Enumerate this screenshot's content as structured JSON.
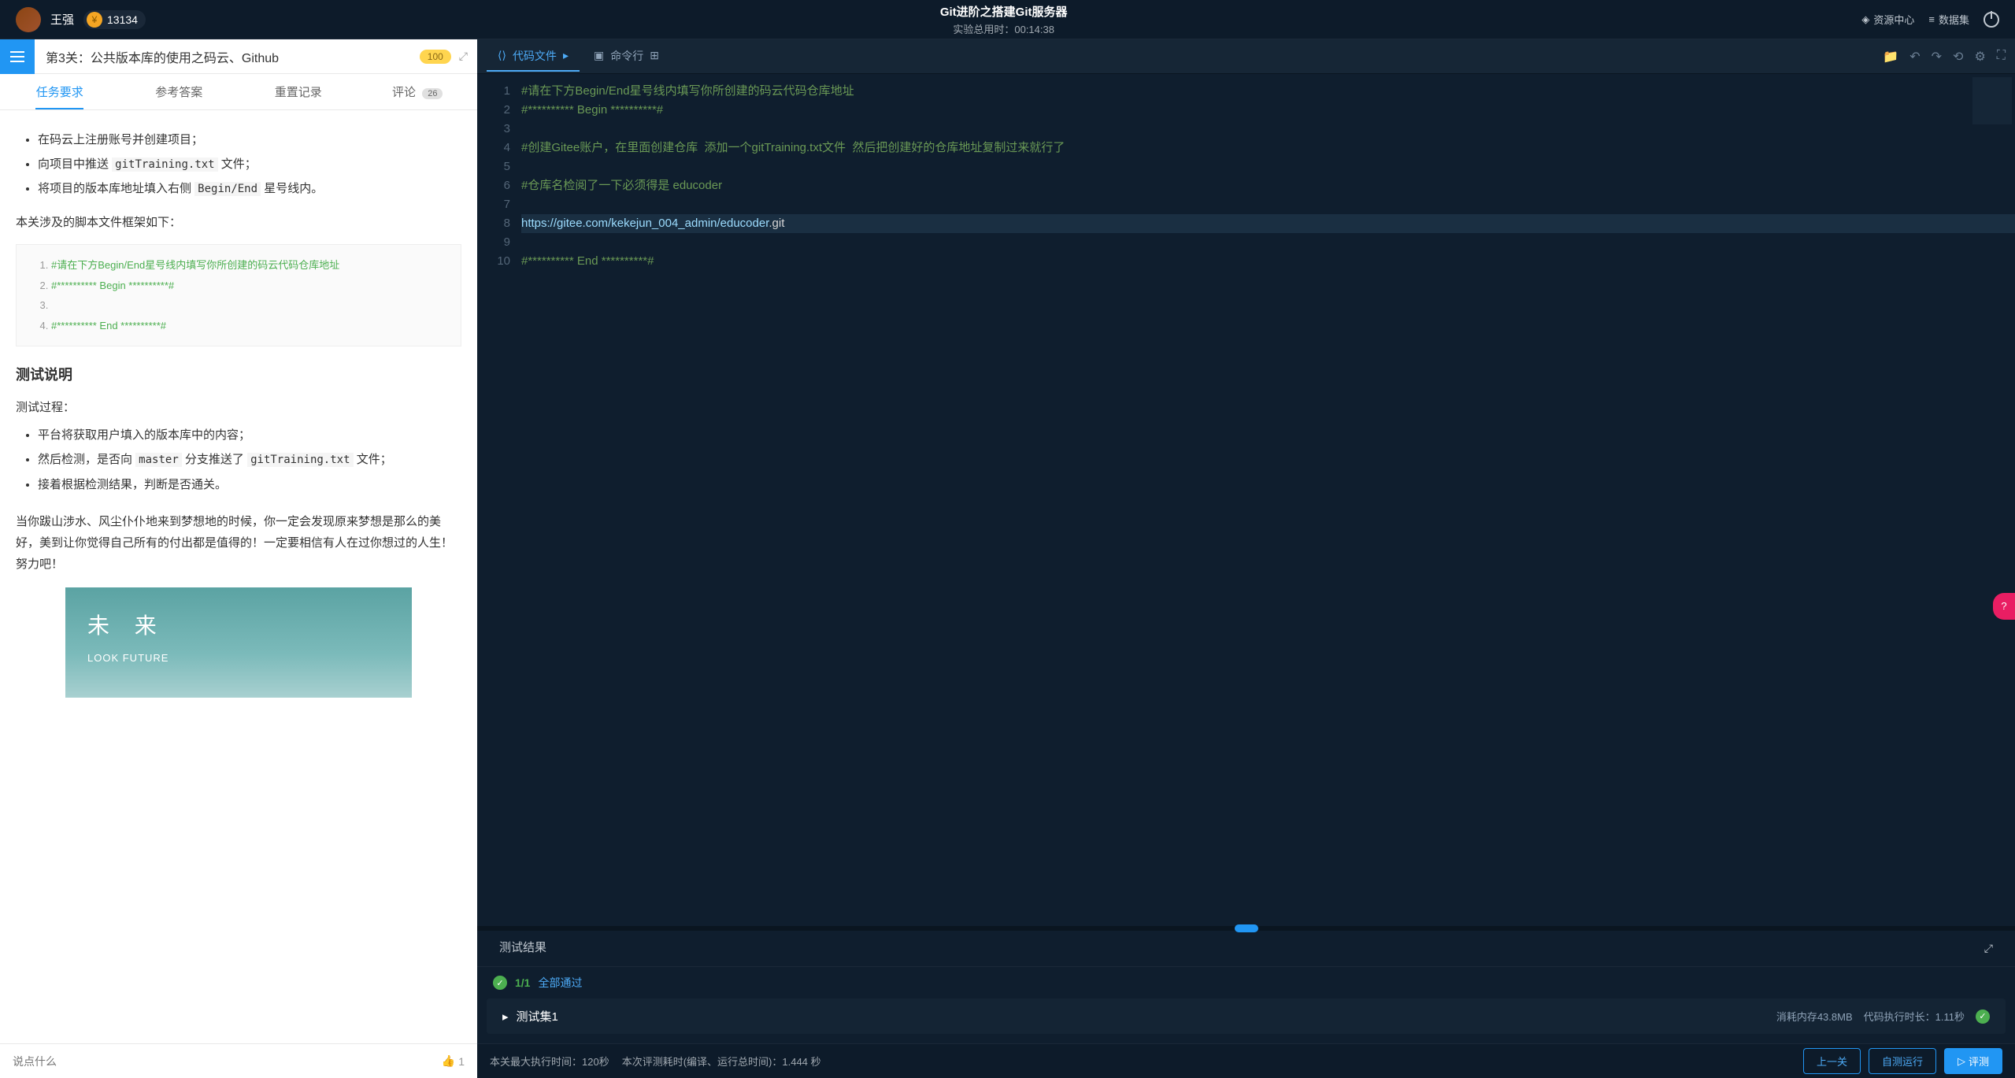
{
  "header": {
    "username": "王强",
    "coins": "13134",
    "title": "Git进阶之搭建Git服务器",
    "elapsed_label": "实验总用时：",
    "elapsed_time": "00:14:38",
    "resource_center": "资源中心",
    "dataset": "数据集"
  },
  "level": {
    "title": "第3关：公共版本库的使用之码云、Github",
    "score": "100"
  },
  "tabs": {
    "t1": "任务要求",
    "t2": "参考答案",
    "t3": "重置记录",
    "t4": "评论",
    "comment_count": "26"
  },
  "task": {
    "bullets": {
      "b1": "在码云上注册账号并创建项目；",
      "b2_pre": "向项目中推送 ",
      "b2_code": "gitTraining.txt",
      "b2_post": " 文件；",
      "b3_pre": "将项目的版本库地址填入右侧 ",
      "b3_code": "Begin/End",
      "b3_post": " 星号线内。"
    },
    "framework_intro": "本关涉及的脚本文件框架如下：",
    "code_lines": {
      "l1": "#请在下方Begin/End星号线内填写你所创建的码云代码仓库地址",
      "l2": "#********** Begin **********#",
      "l3": "",
      "l4": "#********** End **********#"
    },
    "test_heading": "测试说明",
    "test_process_label": "测试过程：",
    "test_bullets": {
      "t1": "平台将获取用户填入的版本库中的内容；",
      "t2_pre": "然后检测，是否向 ",
      "t2_code1": "master",
      "t2_mid": " 分支推送了 ",
      "t2_code2": "gitTraining.txt",
      "t2_post": " 文件；",
      "t3": "接着根据检测结果，判断是否通关。"
    },
    "closing": "当你跋山涉水、风尘仆仆地来到梦想地的时候，你一定会发现原来梦想是那么的美好，美到让你觉得自己所有的付出都是值得的！一定要相信有人在过你想过的人生！努力吧！",
    "illust_cn": "未 来",
    "illust_en": "LOOK FUTURE"
  },
  "comment": {
    "placeholder": "说点什么",
    "likes": "1"
  },
  "editor_tabs": {
    "code_file": "代码文件",
    "terminal": "命令行"
  },
  "code": {
    "l1": "#请在下方Begin/End星号线内填写你所创建的码云代码仓库地址",
    "l2": "#********** Begin **********#",
    "l3": "",
    "l4": "#创建Gitee账户，在里面创建仓库  添加一个gitTraining.txt文件  然后把创建好的仓库地址复制过来就行了",
    "l5": "",
    "l6": "#仓库名检阅了一下必须得是 educoder",
    "l7": "",
    "l8_url": "https://gitee.com/kekejun_004_admin/educoder",
    "l8_ext": ".git",
    "l9": "",
    "l10": "#********** End **********#"
  },
  "results": {
    "title": "测试结果",
    "count": "1/1",
    "all_pass": "全部通过",
    "set_label": "测试集1",
    "mem_label": "消耗内存",
    "mem_value": "43.8MB",
    "time_label": "代码执行时长：",
    "time_value": "1.11秒"
  },
  "bottom": {
    "max_time_label": "本关最大执行时间：",
    "max_time_value": "120秒",
    "eval_time": "本次评测耗时(编译、运行总时间)：1.444 秒",
    "prev": "上一关",
    "self_run": "自测运行",
    "evaluate": "评测"
  }
}
